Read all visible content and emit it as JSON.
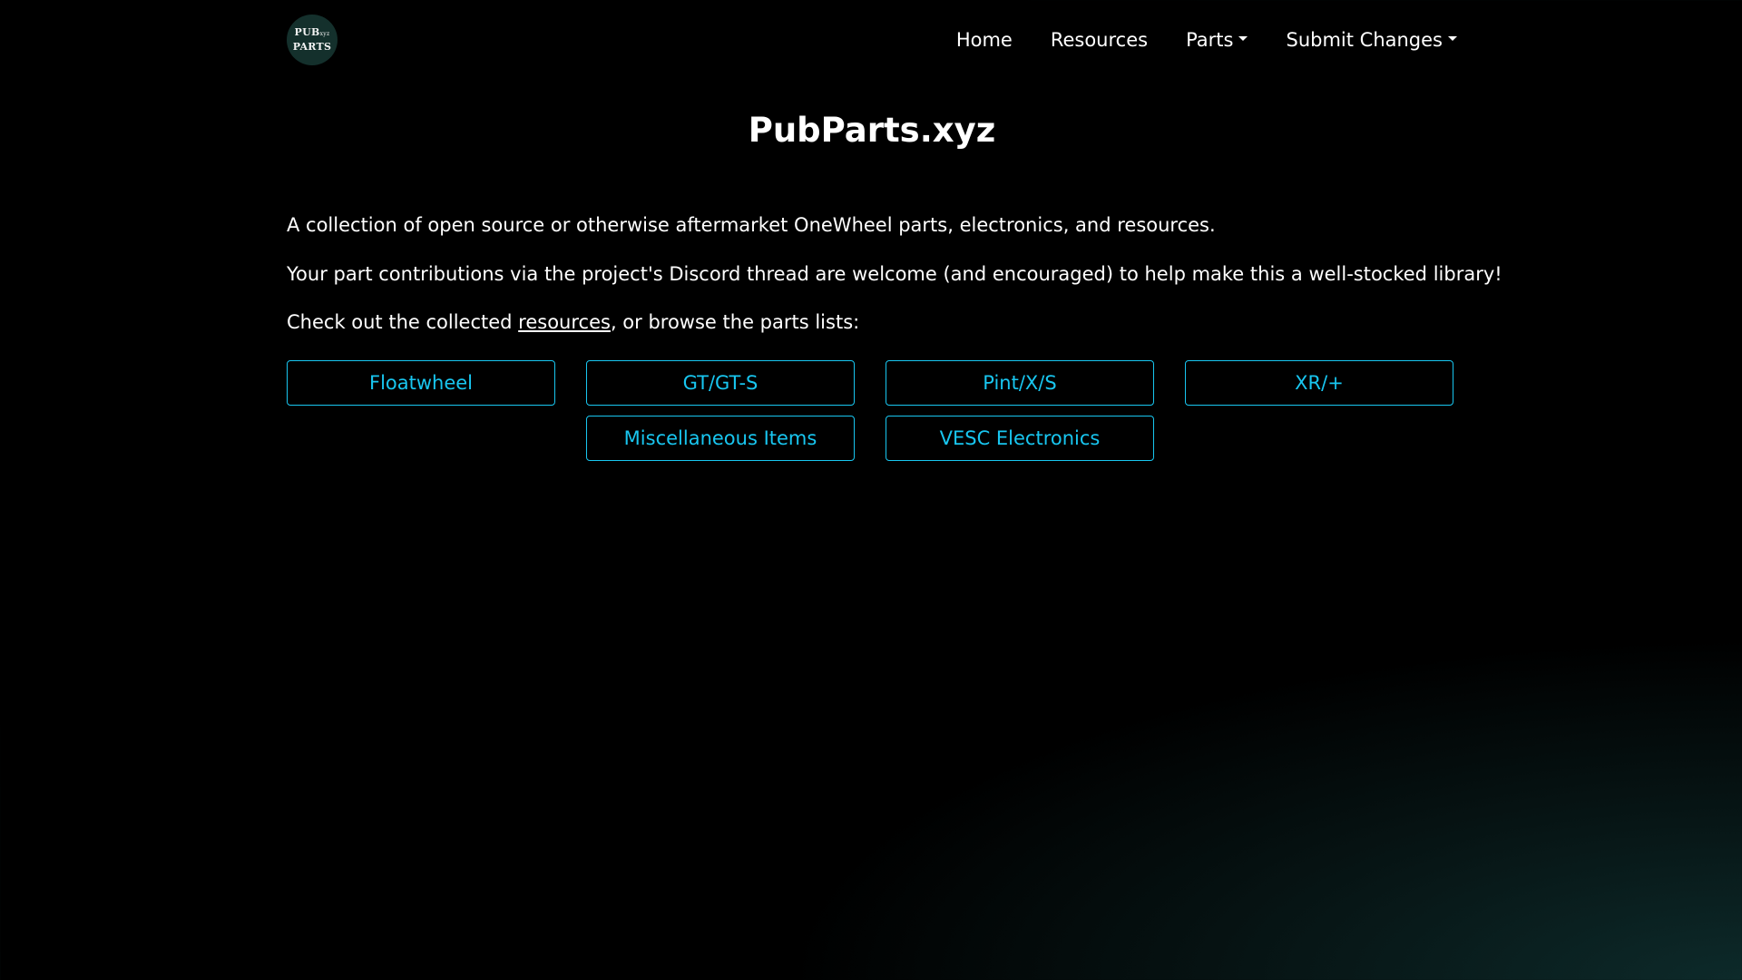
{
  "nav": {
    "logo": {
      "line1": "PUB",
      "line1_small": "xyz",
      "line2": "PARTS"
    },
    "items": [
      {
        "label": "Home"
      },
      {
        "label": "Resources"
      },
      {
        "label": "Parts",
        "dropdown": true
      },
      {
        "label": "Submit Changes",
        "dropdown": true
      }
    ]
  },
  "page": {
    "title": "PubParts.xyz",
    "intro": "A collection of open source or otherwise aftermarket OneWheel parts, electronics, and resources.",
    "contrib": "Your part contributions via the project's Discord thread are welcome (and encouraged) to help make this a well-stocked library!",
    "browse_prefix": "Check out the collected ",
    "browse_link": "resources",
    "browse_suffix": ", or browse the parts lists:"
  },
  "buttons": [
    {
      "label": "Floatwheel"
    },
    {
      "label": "GT/GT-S"
    },
    {
      "label": "Pint/X/S"
    },
    {
      "label": "XR/+"
    },
    {
      "label": "Miscellaneous Items"
    },
    {
      "label": "VESC Electronics"
    }
  ],
  "colors": {
    "accent": "#18c6f0",
    "background": "#000000",
    "logo_bg": "#14302c"
  }
}
